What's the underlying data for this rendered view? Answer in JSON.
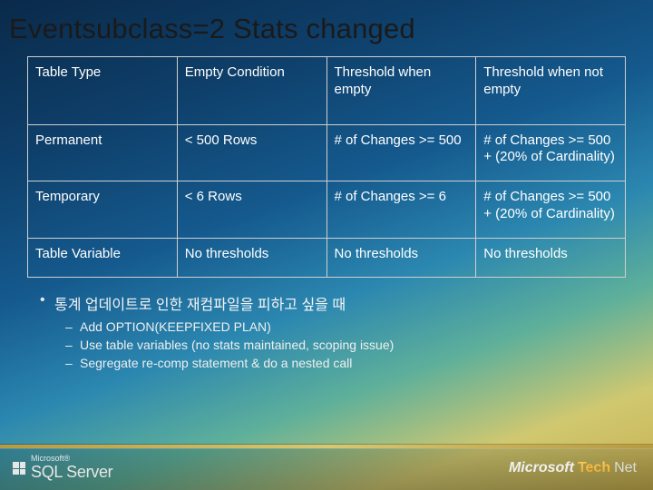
{
  "title": "Eventsubclass=2 Stats changed",
  "table": {
    "headers": [
      "Table Type",
      "Empty Condition",
      "Threshold when empty",
      "Threshold when not empty"
    ],
    "rows": [
      [
        "Permanent",
        "< 500 Rows",
        "# of Changes >= 500",
        "# of Changes >= 500 + (20% of Cardinality)"
      ],
      [
        "Temporary",
        "< 6 Rows",
        "# of Changes >= 6",
        "# of Changes >= 500 + (20% of Cardinality)"
      ],
      [
        "Table Variable",
        "No thresholds",
        "No thresholds",
        "No thresholds"
      ]
    ]
  },
  "bullets": {
    "main": "통계 업데이트로 인한 재컴파일을 피하고 싶을 때",
    "subs": [
      "Add OPTION(KEEPFIXED PLAN)",
      "Use table variables (no stats maintained, scoping issue)",
      "Segregate re-comp statement & do a nested call"
    ]
  },
  "footer": {
    "left_small": "Microsoft®",
    "left_product": "SQL Server",
    "right_ms": "Microsoft",
    "right_tech": "Tech",
    "right_net": "Net"
  }
}
